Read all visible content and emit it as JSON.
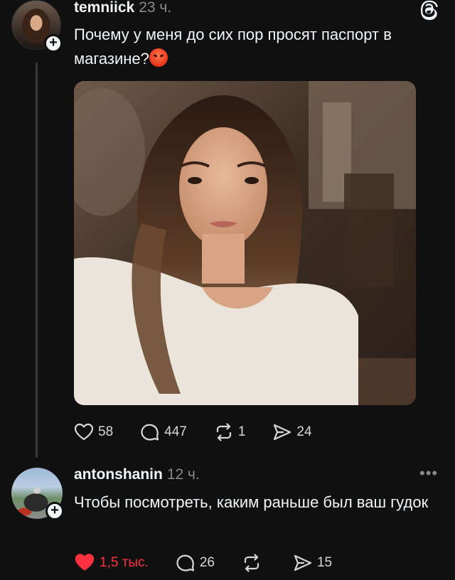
{
  "post": {
    "username": "temniick",
    "time": "23 ч.",
    "text": "Почему у меня до сих пор просят паспорт в магазине?",
    "emoji": "angry-face-emoji",
    "stats": {
      "likes": "58",
      "replies": "447",
      "reposts": "1",
      "shares": "24"
    }
  },
  "reply": {
    "username": "antonshanin",
    "time": "12 ч.",
    "text": "Чтобы посмотреть, каким раньше был ваш гудок",
    "stats": {
      "likes": "1,5 тыс.",
      "replies": "26",
      "reposts": "",
      "shares": "15"
    },
    "liked": true
  },
  "icons": {
    "app": "threads-logo-icon",
    "like": "heart-icon",
    "reply": "comment-icon",
    "repost": "repost-icon",
    "share": "share-icon",
    "more": "more-options-icon"
  },
  "colors": {
    "background": "#101010",
    "text": "#f3f5f7",
    "muted": "#8a8a8a",
    "like_active": "#ff3040"
  }
}
